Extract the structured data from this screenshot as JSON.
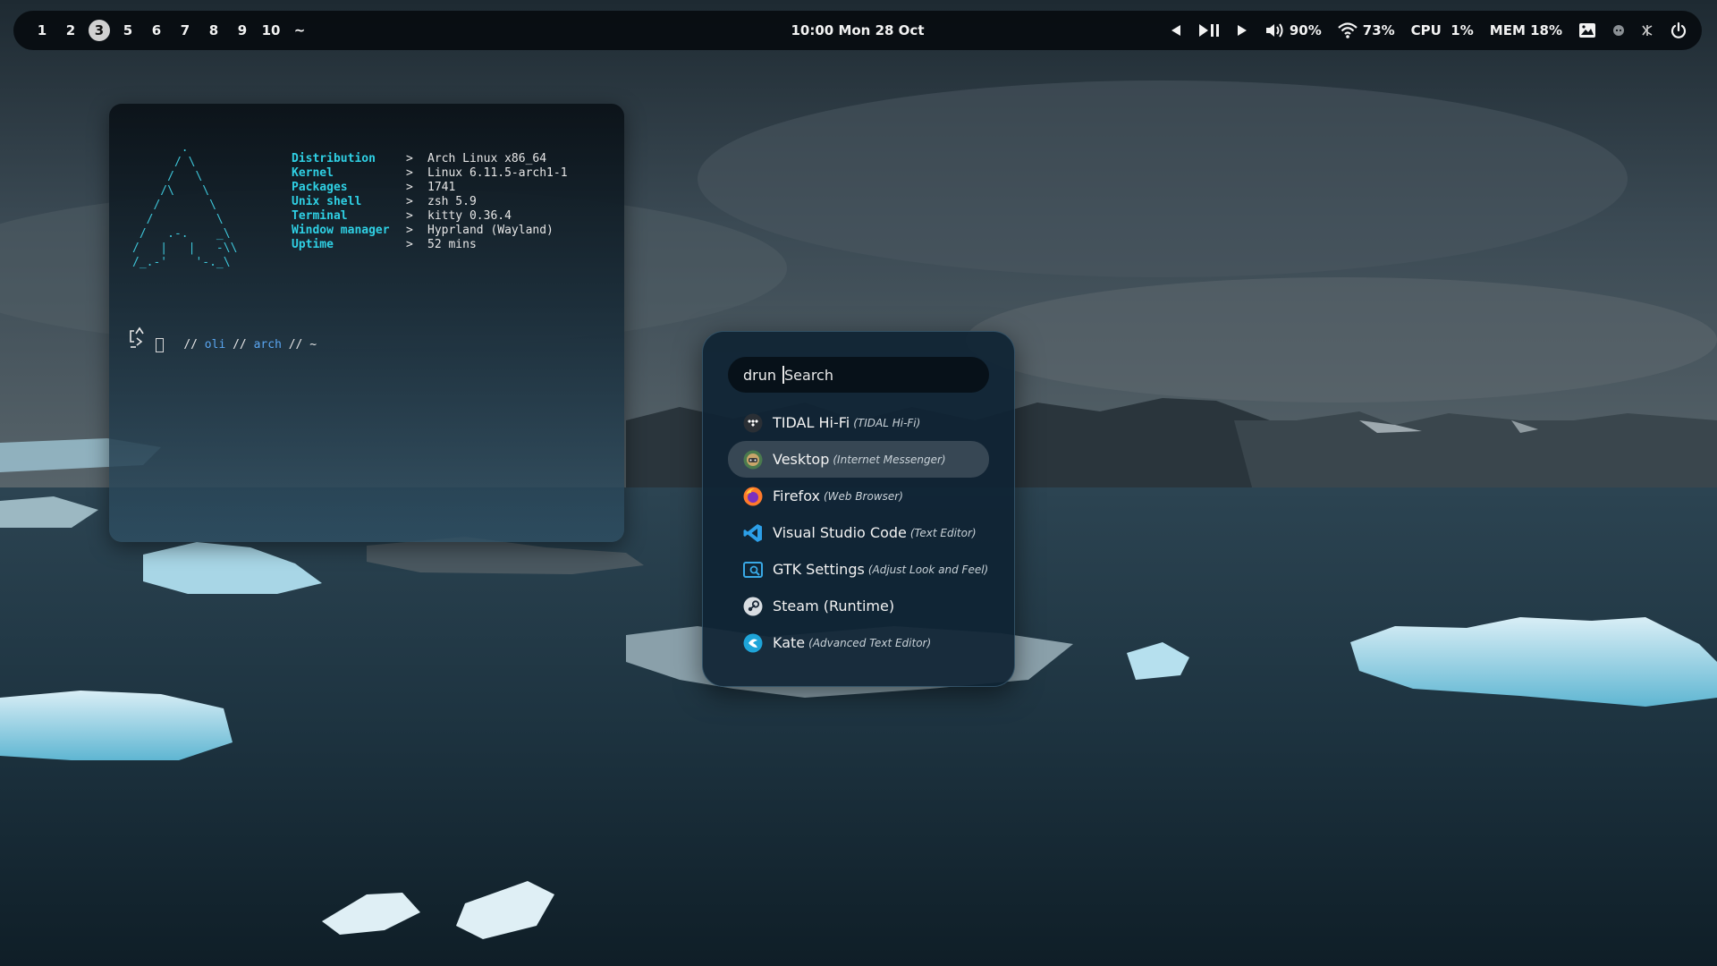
{
  "workspaces": [
    {
      "label": "1",
      "active": false
    },
    {
      "label": "2",
      "active": false
    },
    {
      "label": "3",
      "active": true
    },
    {
      "label": "5",
      "active": false
    },
    {
      "label": "6",
      "active": false
    },
    {
      "label": "7",
      "active": false
    },
    {
      "label": "8",
      "active": false
    },
    {
      "label": "9",
      "active": false
    },
    {
      "label": "10",
      "active": false
    },
    {
      "label": "~",
      "active": false
    }
  ],
  "clock": "10:00 Mon 28 Oct",
  "status": {
    "volume": "90%",
    "wifi": "73%",
    "cpu": "CPU  1%",
    "mem": "MEM 18%"
  },
  "terminal": {
    "ascii_logo": "       .\n      / \\\n     /   \\\n    /\\    \\\n   /       \\\n  /         \\\n /   .-.    _\\\n/   |   |   -\\\\\n/_.-'    '-._\\",
    "info": [
      {
        "key": "Distribution",
        "sep": ">",
        "value": "Arch Linux x86_64"
      },
      {
        "key": "Kernel",
        "sep": ">",
        "value": "Linux 6.11.5-arch1-1"
      },
      {
        "key": "Packages",
        "sep": ">",
        "value": "1741"
      },
      {
        "key": "Unix shell",
        "sep": ">",
        "value": "zsh 5.9"
      },
      {
        "key": "Terminal",
        "sep": ">",
        "value": "kitty 0.36.4"
      },
      {
        "key": "Window manager",
        "sep": ">",
        "value": "Hyprland (Wayland)"
      },
      {
        "key": "Uptime",
        "sep": ">",
        "value": "52 mins"
      }
    ],
    "prompt": {
      "sep1": "// ",
      "user": "oli",
      "sep2": " // ",
      "host": "arch",
      "sep3": " // ",
      "path": "~"
    }
  },
  "launcher": {
    "mode": "drun",
    "placeholder": "Search",
    "results": [
      {
        "name": "TIDAL Hi-Fi",
        "desc": "(TIDAL Hi-Fi)",
        "icon": "tidal-icon",
        "selected": false
      },
      {
        "name": "Vesktop",
        "desc": "(Internet Messenger)",
        "icon": "vesktop-icon",
        "selected": true
      },
      {
        "name": "Firefox",
        "desc": "(Web Browser)",
        "icon": "firefox-icon",
        "selected": false
      },
      {
        "name": "Visual Studio Code",
        "desc": "(Text Editor)",
        "icon": "vscode-icon",
        "selected": false
      },
      {
        "name": "GTK Settings",
        "desc": "(Adjust Look and Feel)",
        "icon": "gtk-settings-icon",
        "selected": false
      },
      {
        "name": "Steam (Runtime)",
        "desc": "",
        "icon": "steam-icon",
        "selected": false
      },
      {
        "name": "Kate",
        "desc": "(Advanced Text Editor)",
        "icon": "kate-icon",
        "selected": false
      }
    ]
  }
}
